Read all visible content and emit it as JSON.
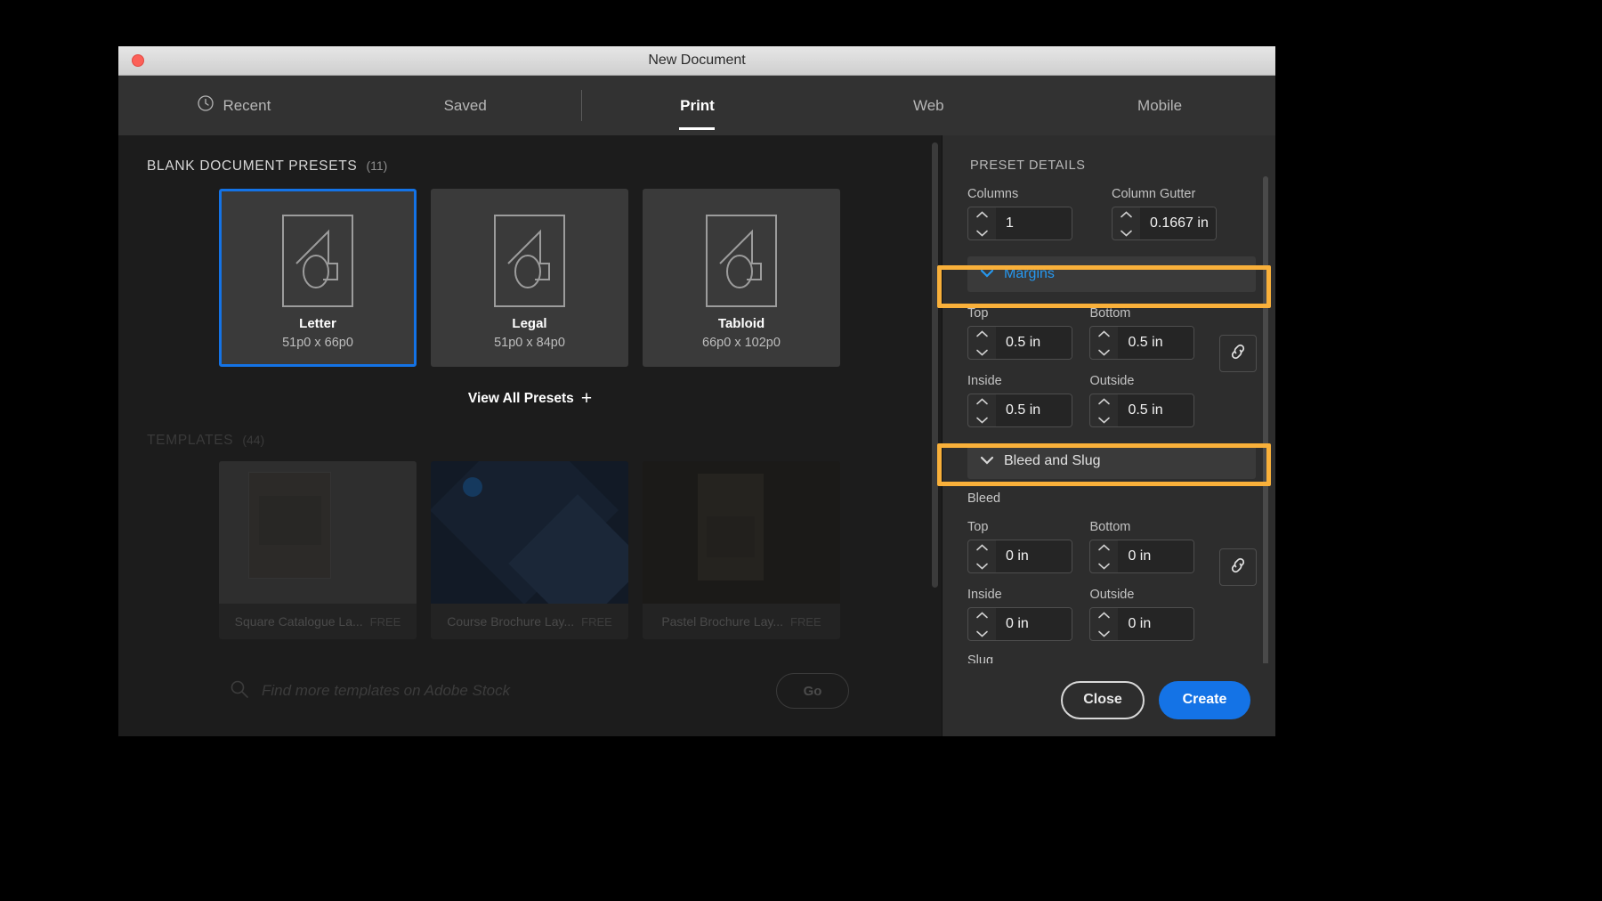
{
  "window": {
    "title": "New Document",
    "close_dot": "red-close-dot"
  },
  "tabs": [
    {
      "label": "Recent",
      "icon": "clock-icon",
      "active": false
    },
    {
      "label": "Saved",
      "icon": "",
      "active": false
    },
    {
      "label": "Print",
      "icon": "",
      "active": true
    },
    {
      "label": "Web",
      "icon": "",
      "active": false
    },
    {
      "label": "Mobile",
      "icon": "",
      "active": false
    }
  ],
  "presets_section": {
    "title": "BLANK DOCUMENT PRESETS",
    "count": "(11)",
    "cards": [
      {
        "name": "Letter",
        "dims": "51p0 x 66p0",
        "selected": true
      },
      {
        "name": "Legal",
        "dims": "51p0 x 84p0",
        "selected": false
      },
      {
        "name": "Tabloid",
        "dims": "66p0 x 102p0",
        "selected": false
      }
    ],
    "view_all": "View All Presets",
    "view_all_plus": "+"
  },
  "templates_section": {
    "title": "TEMPLATES",
    "count": "(44)",
    "cards": [
      {
        "title": "Square Catalogue La...",
        "badge": "FREE"
      },
      {
        "title": "Course Brochure Lay...",
        "badge": "FREE"
      },
      {
        "title": "Pastel Brochure Lay...",
        "badge": "FREE"
      }
    ]
  },
  "stock_search": {
    "placeholder": "Find more templates on Adobe Stock",
    "value": "",
    "go_label": "Go",
    "icon": "search-icon"
  },
  "preset_details": {
    "title": "PRESET DETAILS",
    "columns": {
      "label": "Columns",
      "value": "1"
    },
    "column_gutter": {
      "label": "Column Gutter",
      "value": "0.1667 in"
    },
    "margins": {
      "header": "Margins",
      "highlighted": true,
      "chevron": "chevron-down-icon",
      "fields": [
        {
          "label": "Top",
          "value": "0.5 in"
        },
        {
          "label": "Bottom",
          "value": "0.5 in"
        },
        {
          "label": "Inside",
          "value": "0.5 in"
        },
        {
          "label": "Outside",
          "value": "0.5 in"
        }
      ],
      "link_icon": "link-chain-icon"
    },
    "bleed_and_slug": {
      "header": "Bleed and Slug",
      "highlighted": true,
      "chevron": "chevron-down-icon",
      "bleed_label": "Bleed",
      "fields": [
        {
          "label": "Top",
          "value": "0 in"
        },
        {
          "label": "Bottom",
          "value": "0 in"
        },
        {
          "label": "Inside",
          "value": "0 in"
        },
        {
          "label": "Outside",
          "value": "0 in"
        }
      ],
      "link_icon": "link-chain-icon",
      "slug_label": "Slug"
    }
  },
  "footer": {
    "close_label": "Close",
    "create_label": "Create"
  },
  "colors": {
    "accent_blue": "#1473e6",
    "highlight_orange": "#f9b03a",
    "link_blue": "#2698f0",
    "panel_bg": "#2d2d2d",
    "content_bg": "#1c1c1c"
  }
}
